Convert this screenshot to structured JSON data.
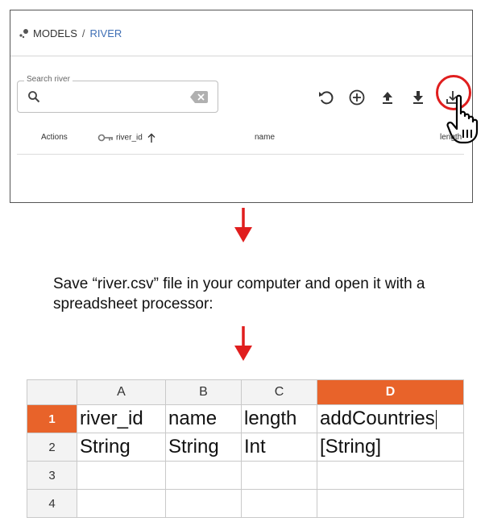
{
  "breadcrumb": {
    "root": "MODELS",
    "separator": "/",
    "current": "RIVER"
  },
  "search": {
    "legend": "Search river",
    "value": ""
  },
  "table": {
    "columns": [
      {
        "label": "Actions"
      },
      {
        "label": "river_id"
      },
      {
        "label": "name"
      },
      {
        "label": "length"
      }
    ]
  },
  "toolbar": {
    "icons": [
      "undo-icon",
      "add-circle-icon",
      "upload-icon",
      "download-icon",
      "download-csv-icon"
    ]
  },
  "caption": {
    "text": "Save “river.csv” file in your computer and open it with a spreadsheet processor:"
  },
  "spreadsheet": {
    "column_headers": [
      "A",
      "B",
      "C",
      "D"
    ],
    "active_column": "D",
    "active_row": "1",
    "rows": [
      {
        "num": "1",
        "cells": [
          "river_id",
          "name",
          "length",
          "addCountries"
        ]
      },
      {
        "num": "2",
        "cells": [
          "String",
          "String",
          "Int",
          "[String]"
        ]
      },
      {
        "num": "3",
        "cells": [
          "",
          "",
          "",
          ""
        ]
      },
      {
        "num": "4",
        "cells": [
          "",
          "",
          "",
          ""
        ]
      }
    ]
  },
  "colors": {
    "highlight_ring": "#e01e1e",
    "arrow": "#e01e1e",
    "active_header": "#e8632a",
    "breadcrumb_link": "#3f6fb5"
  }
}
